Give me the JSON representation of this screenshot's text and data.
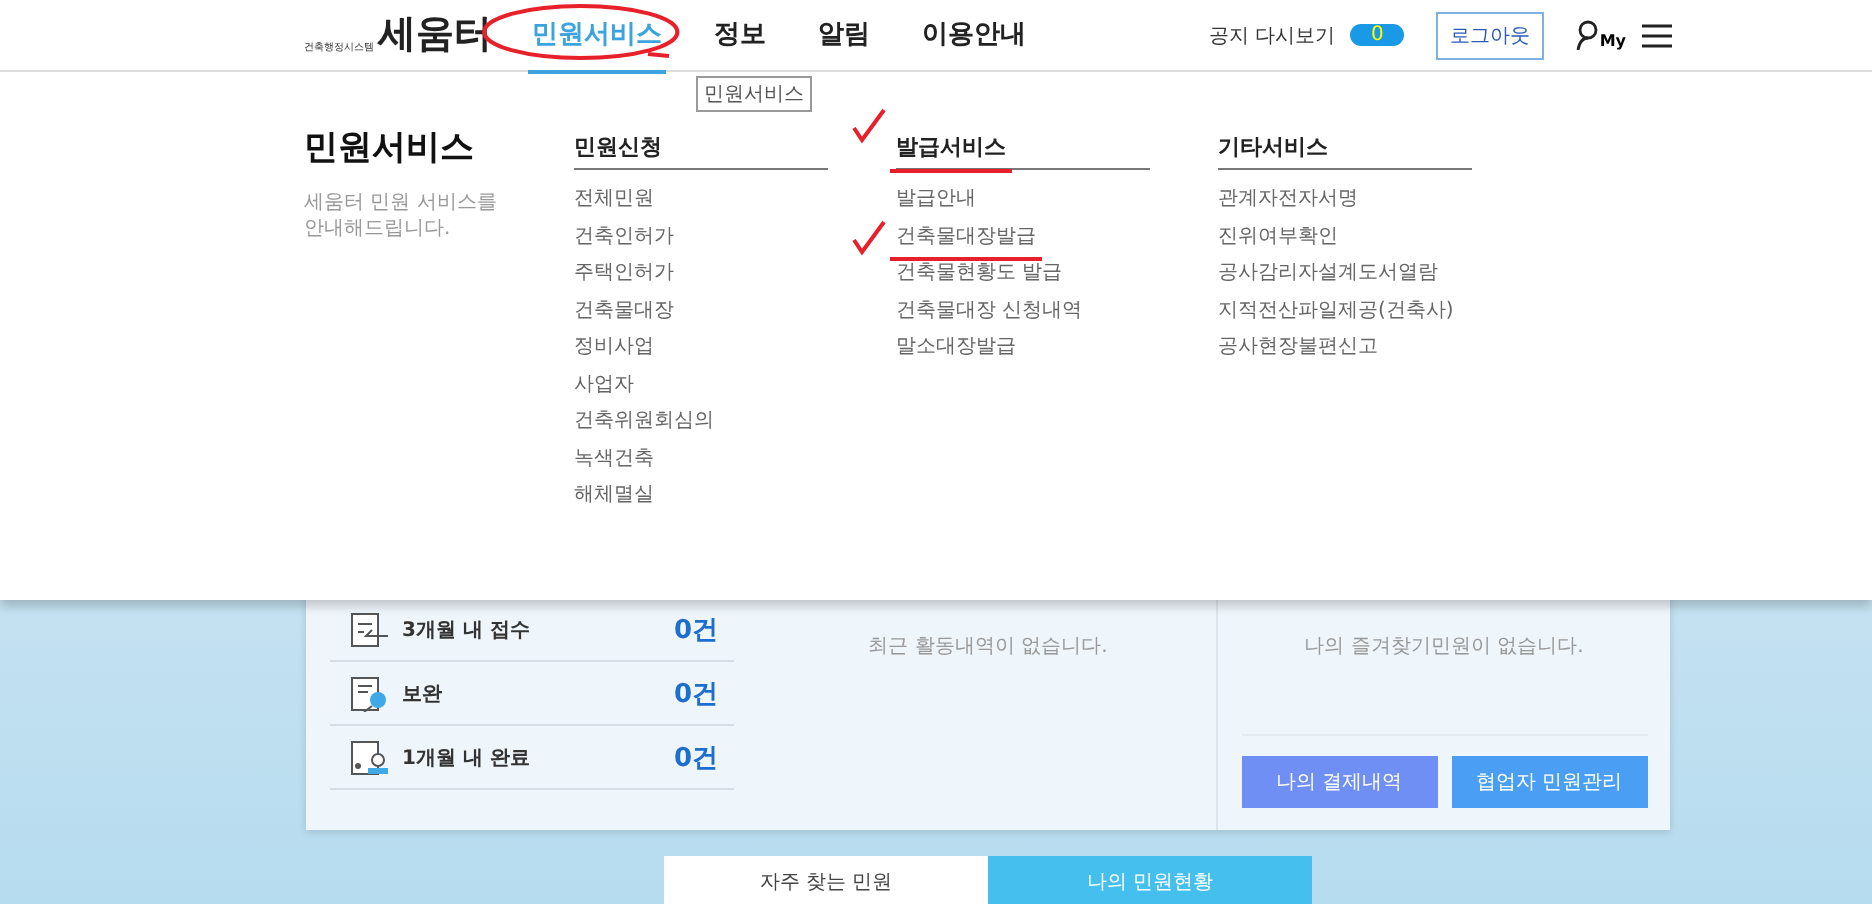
{
  "header": {
    "logo": {
      "subtitle": "건축행정시스템",
      "wordmark": "세움터"
    },
    "nav": [
      {
        "label": "민원서비스",
        "selected": true,
        "circled": true
      },
      {
        "label": "정보",
        "selected": false
      },
      {
        "label": "알림",
        "selected": false
      },
      {
        "label": "이용안내",
        "selected": false
      }
    ],
    "tooltip": "민원서비스",
    "notice": {
      "label": "공지 다시보기",
      "count": "0"
    },
    "logout": "로그아웃",
    "my_label": "My"
  },
  "mega_menu": {
    "title": "민원서비스",
    "description": "세움터 민원 서비스를 안내해드립니다.",
    "columns": [
      {
        "heading": "민원신청",
        "items": [
          {
            "label": "전체민원"
          },
          {
            "label": "건축인허가"
          },
          {
            "label": "주택인허가"
          },
          {
            "label": "건축물대장"
          },
          {
            "label": "정비사업"
          },
          {
            "label": "사업자"
          },
          {
            "label": "건축위원회심의"
          },
          {
            "label": "녹색건축"
          },
          {
            "label": "해체멸실"
          }
        ]
      },
      {
        "heading": "발급서비스",
        "checked": true,
        "underlined": true,
        "items": [
          {
            "label": "발급안내"
          },
          {
            "label": "건축물대장발급",
            "checked": true,
            "underlined": true
          },
          {
            "label": "건축물현황도 발급"
          },
          {
            "label": "건축물대장 신청내역"
          },
          {
            "label": "말소대장발급"
          }
        ]
      },
      {
        "heading": "기타서비스",
        "items": [
          {
            "label": "관계자전자서명"
          },
          {
            "label": "진위여부확인"
          },
          {
            "label": "공사감리자설계도서열람"
          },
          {
            "label": "지적전산파일제공(건축사)"
          },
          {
            "label": "공사현장불편신고"
          }
        ]
      }
    ]
  },
  "dashboard": {
    "stats": [
      {
        "kind": "received",
        "label": "3개월 내 접수",
        "count": "0건"
      },
      {
        "kind": "supplement",
        "label": "보완",
        "count": "0건"
      },
      {
        "kind": "completed",
        "label": "1개월 내 완료",
        "count": "0건"
      }
    ],
    "recent_empty": "최근 활동내역이 없습니다.",
    "favorites_empty": "나의 즐겨찾기민원이 없습니다.",
    "buttons": [
      {
        "label": "나의 결제내역",
        "color": "#6f8ff5"
      },
      {
        "label": "협업자 민원관리",
        "color": "#4a9ff5"
      }
    ]
  },
  "tabs": [
    {
      "label": "자주 찾는 민원",
      "selected": false
    },
    {
      "label": "나의 민원현황",
      "selected": true
    }
  ]
}
